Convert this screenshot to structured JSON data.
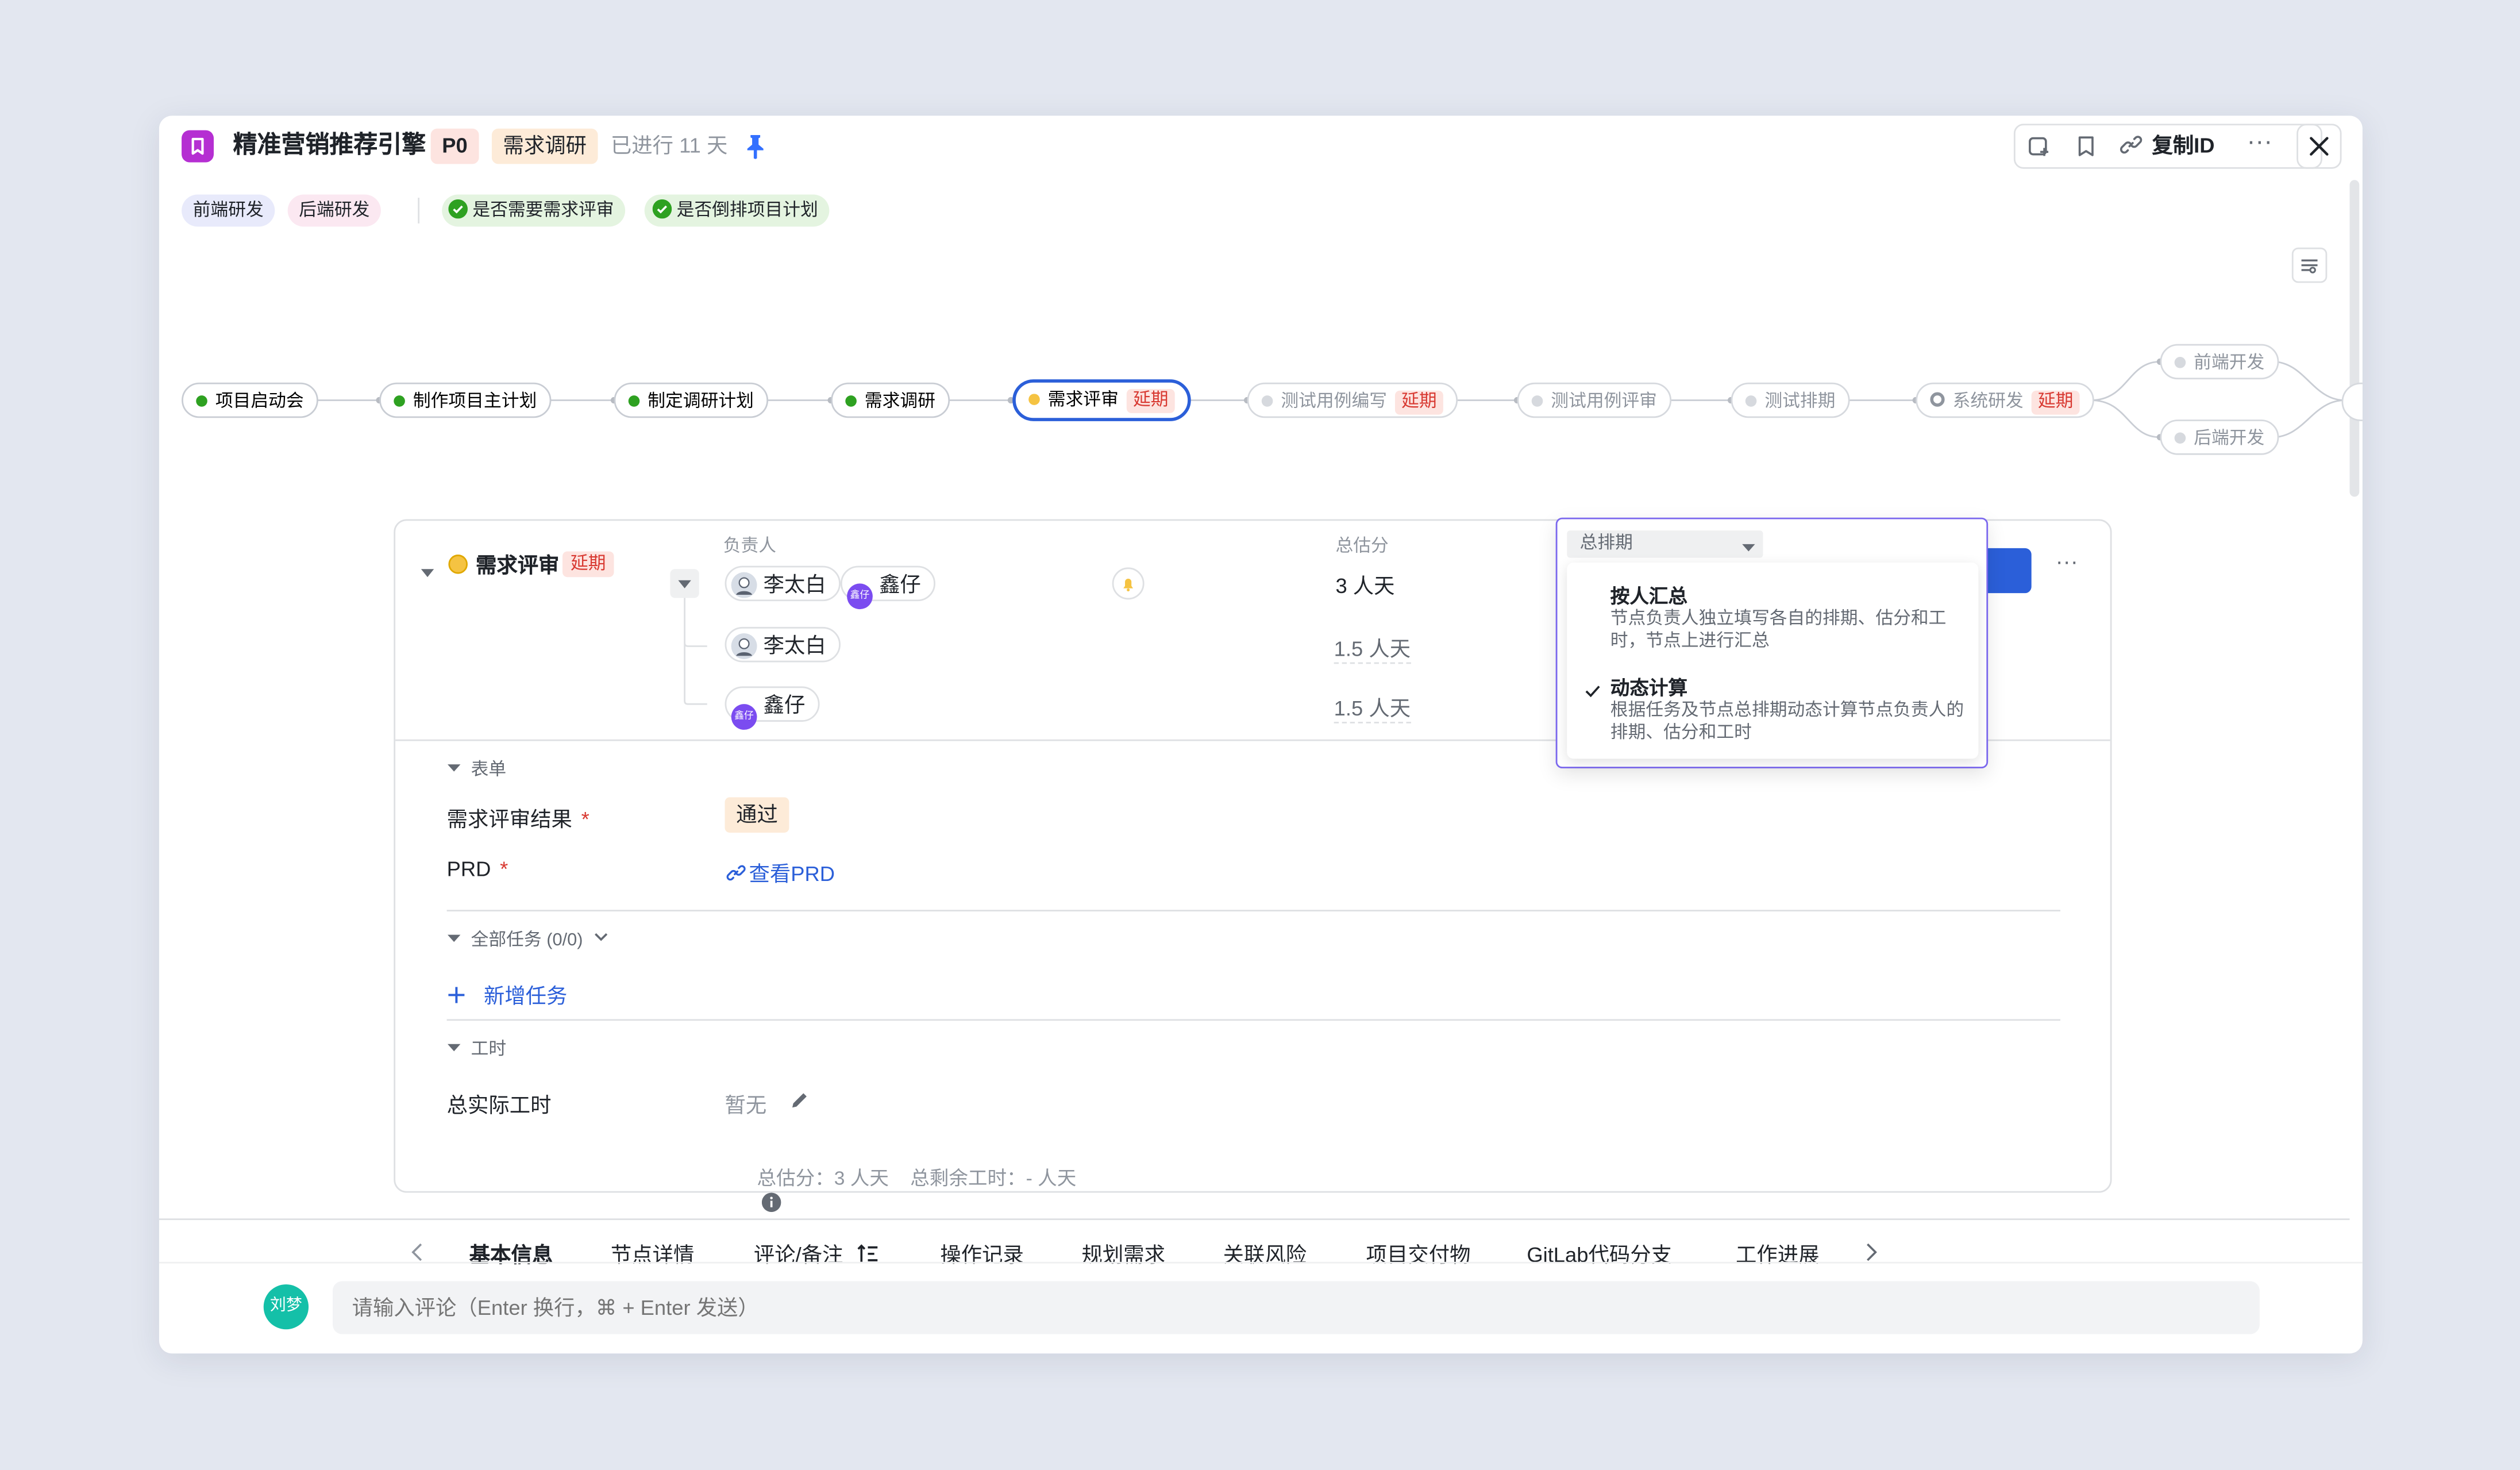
{
  "header": {
    "title": "精准营销推荐引擎",
    "priority": "P0",
    "stage": "需求调研",
    "elapsed": "已进行 11 天",
    "copy_id_label": "复制ID"
  },
  "tags": [
    {
      "label": "前端研发"
    },
    {
      "label": "后端研发"
    },
    {
      "label": "是否需要需求评审"
    },
    {
      "label": "是否倒排项目计划"
    }
  ],
  "flow": {
    "late_label": "延期",
    "nodes": [
      {
        "label": "项目启动会"
      },
      {
        "label": "制作项目主计划"
      },
      {
        "label": "制定调研计划"
      },
      {
        "label": "需求调研"
      },
      {
        "label": "需求评审"
      },
      {
        "label": "测试用例编写"
      },
      {
        "label": "测试用例评审"
      },
      {
        "label": "测试排期"
      },
      {
        "label": "系统研发"
      },
      {
        "label": "前端开发"
      },
      {
        "label": "后端开发"
      }
    ]
  },
  "node_card": {
    "name": "需求评审",
    "late_label": "延期",
    "owner_header": "负责人",
    "estimate_header": "总估分",
    "owners": [
      {
        "name": "李太白"
      },
      {
        "name": "鑫仔",
        "avatar_text": "鑫仔"
      }
    ],
    "rows": [
      {
        "owner": "李太白",
        "estimate": "1.5 人天"
      },
      {
        "owner": "鑫仔",
        "avatar_text": "鑫仔",
        "estimate": "1.5 人天"
      }
    ],
    "total_estimate": "3 人天"
  },
  "schedule_dropdown": {
    "selected": "总排期",
    "options": [
      {
        "title": "按人汇总",
        "desc": "节点负责人独立填写各自的排期、估分和工时，节点上进行汇总",
        "checked": false
      },
      {
        "title": "动态计算",
        "desc": "根据任务及节点总排期动态计算节点负责人的排期、估分和工时",
        "checked": true
      }
    ]
  },
  "form": {
    "section_label": "表单",
    "review_result_label": "需求评审结果",
    "review_result_value": "通过",
    "prd_label": "PRD",
    "prd_link": "查看PRD",
    "required_mark": "*"
  },
  "tasks": {
    "section_label": "全部任务 (0/0)",
    "add_label": "新增任务"
  },
  "worktime": {
    "section_label": "工时",
    "actual_label": "总实际工时",
    "actual_value": "暂无",
    "summary": "总估分：3 人天    总剩余工时：- 人天"
  },
  "tabs": [
    {
      "label": "基本信息",
      "active": true
    },
    {
      "label": "节点详情"
    },
    {
      "label": "评论/备注"
    },
    {
      "label": "操作记录"
    },
    {
      "label": "规划需求"
    },
    {
      "label": "关联风险"
    },
    {
      "label": "项目交付物"
    },
    {
      "label": "GitLab代码分支"
    },
    {
      "label": "工作进展"
    }
  ],
  "comment": {
    "avatar_text": "刘梦",
    "placeholder": "请输入评论（Enter 换行，⌘ + Enter 发送）"
  },
  "colors": {
    "done": "#2ea121",
    "current": "#f5c342",
    "pending": "#c9cdd4",
    "accent": "#3370ff",
    "late": "#d83931",
    "brand": "#b52fd2",
    "dropdown_border": "#7b68ee"
  }
}
